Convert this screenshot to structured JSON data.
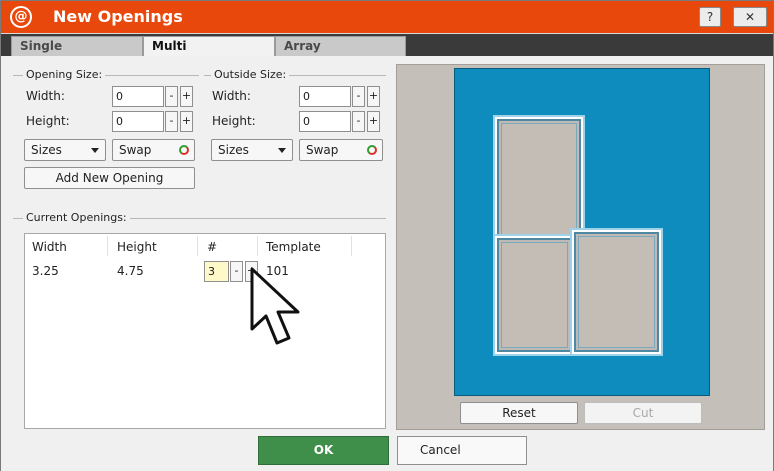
{
  "window": {
    "title": "New Openings",
    "logo_glyph": "@",
    "help_glyph": "?",
    "close_glyph": "✕"
  },
  "tabs": [
    {
      "label": "Single",
      "active": false
    },
    {
      "label": "Multi",
      "active": true
    },
    {
      "label": "Array",
      "active": false
    }
  ],
  "opening_size": {
    "legend": "Opening Size:",
    "width_label": "Width:",
    "width_value": "0",
    "height_label": "Height:",
    "height_value": "0",
    "sizes_label": "Sizes",
    "swap_label": "Swap"
  },
  "outside_size": {
    "legend": "Outside Size:",
    "width_label": "Width:",
    "width_value": "0",
    "height_label": "Height:",
    "height_value": "0",
    "sizes_label": "Sizes",
    "swap_label": "Swap"
  },
  "stepper": {
    "minus": "-",
    "plus": "+"
  },
  "add_button": "Add New Opening",
  "current_openings": {
    "legend": "Current Openings:",
    "columns": [
      "Width",
      "Height",
      "#",
      "Template"
    ],
    "rows": [
      {
        "width": "3.25",
        "height": "4.75",
        "count": "3",
        "template": "101"
      }
    ]
  },
  "preview": {
    "reset_label": "Reset",
    "cut_label": "Cut",
    "cut_enabled": false,
    "background_color": "#0d8cbd"
  },
  "footer": {
    "ok_label": "OK",
    "cancel_label": "Cancel",
    "ok_color": "#3f8f4b"
  },
  "colors": {
    "title_bar": "#e8480b",
    "quantity_highlight": "#fff8c8"
  }
}
